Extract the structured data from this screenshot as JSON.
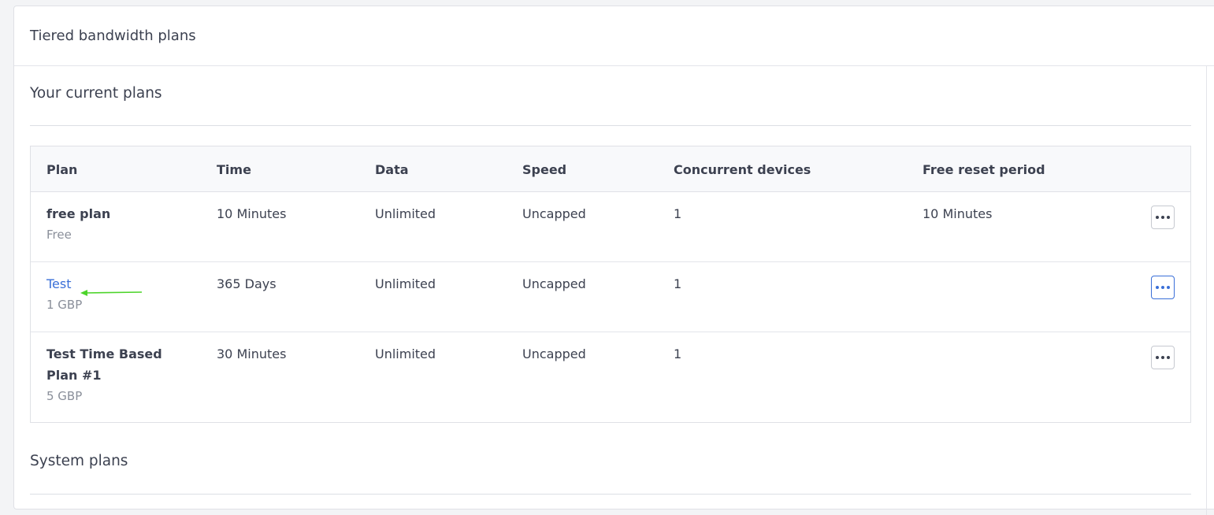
{
  "card": {
    "title": "Tiered bandwidth plans"
  },
  "current_plans": {
    "title": "Your current plans",
    "columns": [
      "Plan",
      "Time",
      "Data",
      "Speed",
      "Concurrent devices",
      "Free reset period"
    ],
    "rows": [
      {
        "name": "free plan",
        "price": "Free",
        "time": "10 Minutes",
        "data": "Unlimited",
        "speed": "Uncapped",
        "devices": "1",
        "reset": "10 Minutes",
        "more_icon": "ellipsis-icon"
      },
      {
        "name": "Test",
        "price": "1 GBP",
        "time": "365 Days",
        "data": "Unlimited",
        "speed": "Uncapped",
        "devices": "1",
        "reset": "",
        "more_icon": "ellipsis-icon"
      },
      {
        "name": "Test Time Based Plan #1",
        "price": "5 GBP",
        "time": "30 Minutes",
        "data": "Unlimited",
        "speed": "Uncapped",
        "devices": "1",
        "reset": "",
        "more_icon": "ellipsis-icon"
      }
    ]
  },
  "system_plans": {
    "title": "System plans"
  },
  "colors": {
    "link": "#3a6fd8",
    "annotation_arrow": "#4cd42a",
    "header_bg": "#f8f9fb"
  }
}
